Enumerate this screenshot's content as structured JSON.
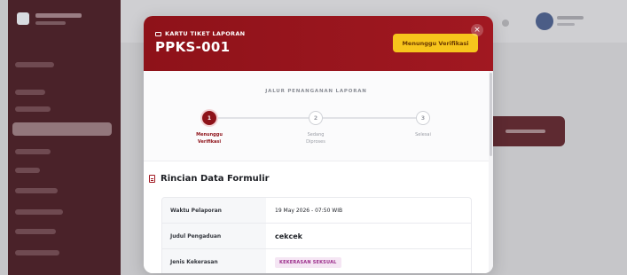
{
  "modal": {
    "kicker": "KARTU TIKET LAPORAN",
    "title": "PPKS-001",
    "status_badge": "Menunggu Verifikasi",
    "close_symbol": "×",
    "progress_title": "JALUR PENANGANAN LAPORAN",
    "steps": [
      {
        "number": "1",
        "label_line1": "Menunggu",
        "label_line2": "Verifikasi",
        "state": "active"
      },
      {
        "number": "2",
        "label_line1": "Sedang",
        "label_line2": "Diproses",
        "state": "idle"
      },
      {
        "number": "3",
        "label_line1": "Selesai",
        "label_line2": "",
        "state": "idle"
      }
    ],
    "details_title": "Rincian Data Formulir",
    "details": [
      {
        "key": "Waktu Pelaporan",
        "value": "19 May 2026 - 07:50 WIB"
      },
      {
        "key": "Judul Pengaduan",
        "value": "cekcek"
      },
      {
        "key": "Jenis Kekerasan",
        "value": "KEKERASAN SEKSUAL"
      }
    ]
  },
  "colors": {
    "header_red": "#8e1219",
    "badge_yellow": "#f7c51c",
    "tag_bg": "#f5e6f4",
    "tag_text": "#9b2c8a"
  },
  "icons": {
    "kicker": "ticket-icon",
    "details": "document-icon",
    "close": "close-icon"
  }
}
